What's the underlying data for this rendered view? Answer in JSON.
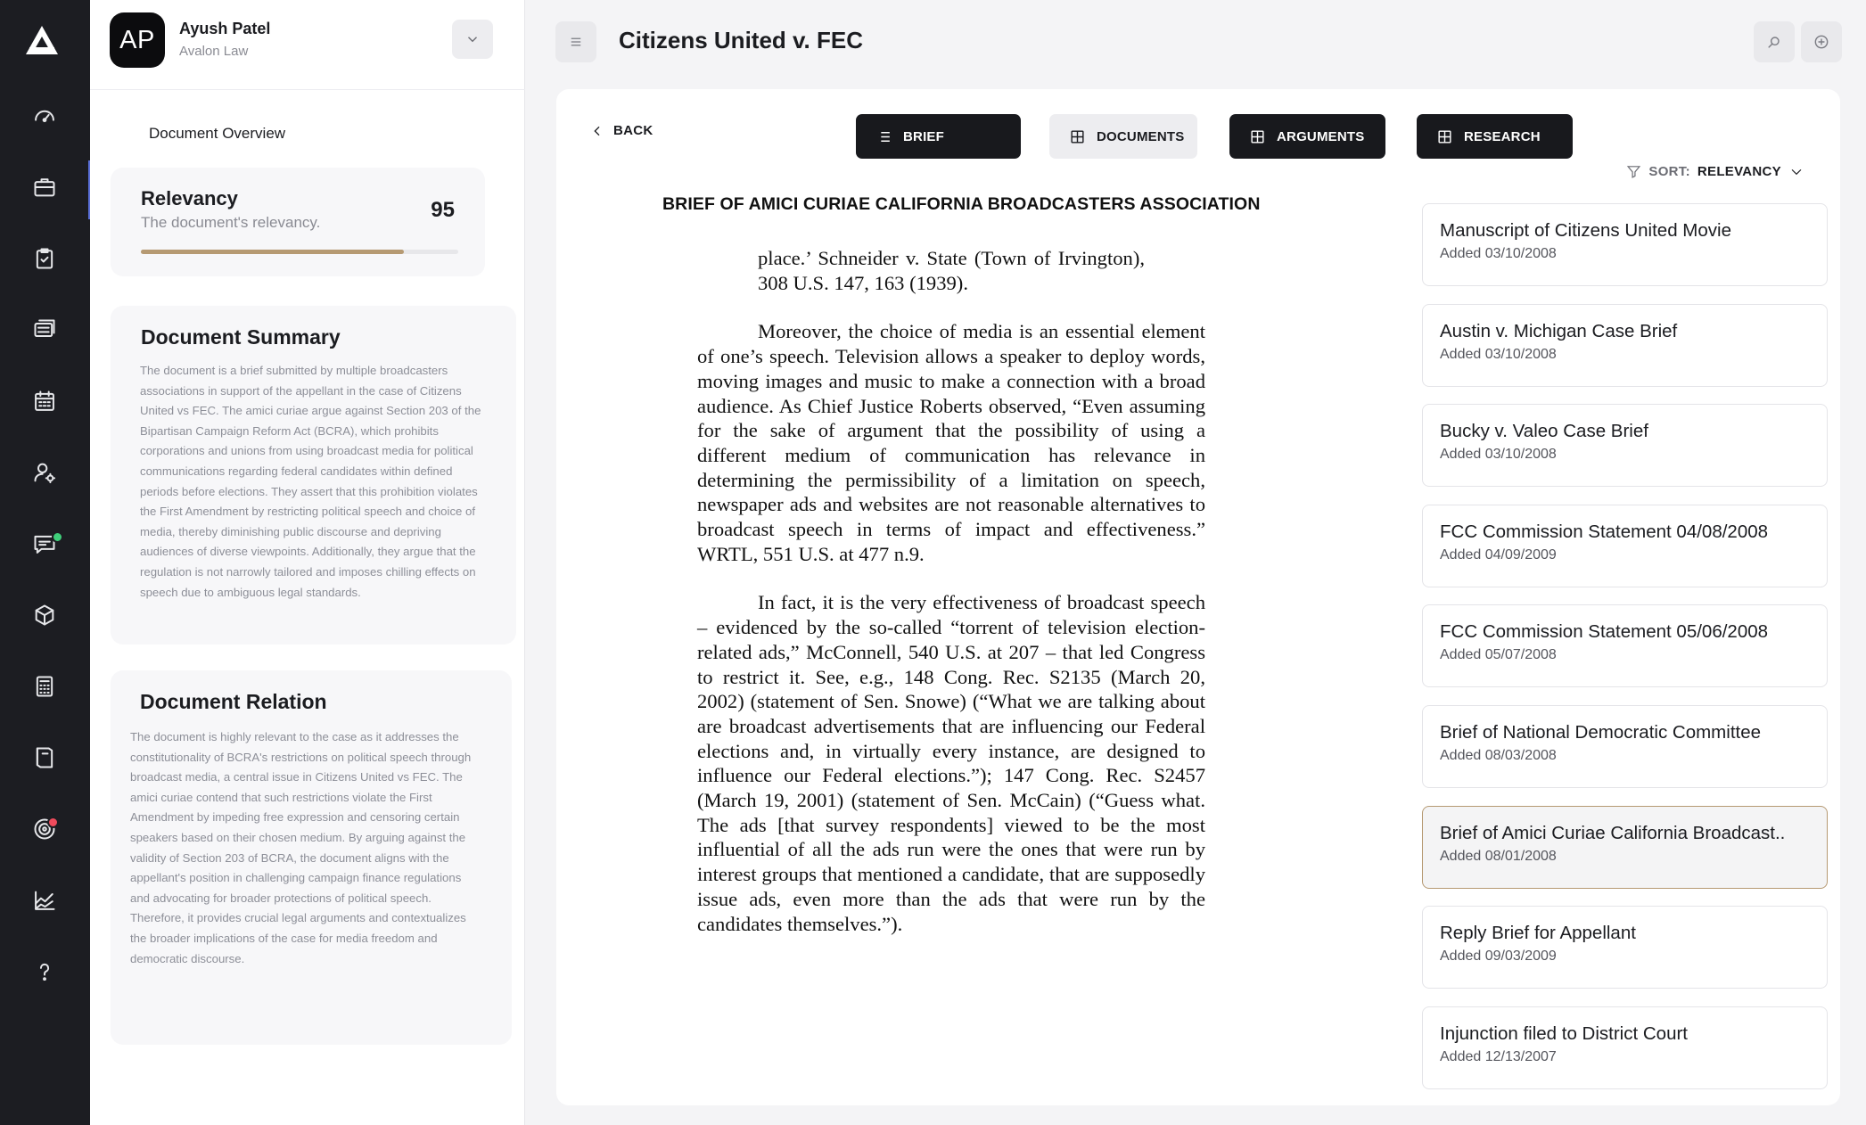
{
  "app": {
    "case_title": "Citizens United v. FEC"
  },
  "rail": {
    "items": [
      {
        "icon": "dashboard-icon"
      },
      {
        "icon": "briefcase-icon",
        "active": true
      },
      {
        "icon": "clipboard-icon"
      },
      {
        "icon": "stack-icon"
      },
      {
        "icon": "calendar-icon"
      },
      {
        "icon": "user-settings-icon"
      },
      {
        "icon": "chat-icon",
        "badge_color": "#3fcf7a"
      },
      {
        "icon": "box-icon"
      },
      {
        "icon": "calculator-icon"
      },
      {
        "icon": "book-icon"
      },
      {
        "icon": "target-icon",
        "badge_color": "#ef4b5c"
      },
      {
        "icon": "chart-icon"
      },
      {
        "icon": "help-icon"
      }
    ]
  },
  "user": {
    "initials": "AP",
    "name": "Ayush Patel",
    "org": "Avalon Law"
  },
  "overview": {
    "title": "Document Overview",
    "relevancy": {
      "title": "Relevancy",
      "subtitle": "The document's relevancy.",
      "value": "95",
      "fraction": 0.83
    },
    "summary": {
      "title": "Document Summary",
      "text": "The document is a brief submitted by multiple broadcasters associations in support of the appellant in the case of Citizens United vs FEC. The amici curiae argue against Section 203 of the Bipartisan Campaign Reform Act (BCRA), which prohibits corporations and unions from using broadcast media for political communications regarding federal candidates within defined periods before elections. They assert that this prohibition violates the First Amendment by restricting political speech and choice of media, thereby diminishing public discourse and depriving audiences of diverse viewpoints. Additionally, they argue that the regulation is not narrowly tailored and imposes chilling effects on speech due to ambiguous legal standards."
    },
    "relation": {
      "title": "Document Relation",
      "text": "The document is highly relevant to the case as it addresses the constitutionality of BCRA's restrictions on political speech through broadcast media, a central issue in Citizens United vs FEC. The amici curiae contend that such restrictions violate the First Amendment by impeding free expression and censoring certain speakers based on their chosen medium. By arguing against the validity of Section 203 of BCRA, the document aligns with the appellant's position in challenging campaign finance regulations and advocating for broader protections of political speech. Therefore, it provides crucial legal arguments and contextualizes the broader implications of the case for media freedom and democratic discourse."
    }
  },
  "nav": {
    "back": "BACK",
    "tabs": [
      {
        "label": "BRIEF",
        "icon": "list-icon",
        "style": "dark"
      },
      {
        "label": "DOCUMENTS",
        "icon": "grid-icon",
        "style": "light"
      },
      {
        "label": "ARGUMENTS",
        "icon": "grid-icon",
        "style": "dark"
      },
      {
        "label": "RESEARCH",
        "icon": "grid-icon",
        "style": "dark"
      }
    ]
  },
  "document": {
    "heading": "BRIEF OF AMICI CURIAE CALIFORNIA BROADCASTERS ASSOCIATION",
    "quote_line": "place.’ Schneider v. State (Town of Irvington), 308 U.S. 147, 163 (1939).",
    "paragraph_1": "Moreover, the choice of media is an essential element of one’s speech. Television allows a speaker to deploy words, moving images and music to make a connection with a broad audience. As Chief Justice Roberts observed, “Even assuming for the sake of argument that the possibility of using a different medium of communication has relevance in determining the permissibility of a limitation on speech, newspaper ads and websites are not reasonable alternatives to broadcast speech in terms of impact and effectiveness.” WRTL, 551 U.S. at 477 n.9.",
    "paragraph_2": "In fact, it is the very effectiveness of broadcast speech – evidenced by the so-called “torrent of television election-related ads,” McConnell, 540 U.S. at 207 – that led Congress to restrict it. See, e.g., 148 Cong. Rec. S2135 (March 20, 2002) (statement of Sen. Snowe) (“What we are talking about are broadcast advertisements that are influencing our Federal elections and, in virtually every instance, are designed to influence our Federal elections.”); 147 Cong. Rec. S2457 (March 19, 2001) (statement of Sen. McCain) (“Guess what. The ads [that survey respondents] viewed to be the most influential of all the ads run were the ones that were run by interest groups that mentioned a candidate, that are supposedly issue ads, even more than the ads that were run by the candidates themselves.”)."
  },
  "sort": {
    "label": "SORT:",
    "value": "RELEVANCY"
  },
  "documents": [
    {
      "title": "Manuscript of Citizens United Movie",
      "added": "Added 03/10/2008"
    },
    {
      "title": "Austin v. Michigan Case Brief",
      "added": "Added 03/10/2008"
    },
    {
      "title": "Bucky v. Valeo Case Brief",
      "added": "Added 03/10/2008"
    },
    {
      "title": "FCC Commission Statement 04/08/2008",
      "added": "Added 04/09/2009"
    },
    {
      "title": "FCC Commission Statement 05/06/2008",
      "added": "Added 05/07/2008"
    },
    {
      "title": "Brief of National Democratic Committee",
      "added": "Added 08/03/2008"
    },
    {
      "title": "Brief of Amici Curiae California Broadcast..",
      "added": "Added 08/01/2008",
      "selected": true
    },
    {
      "title": "Reply Brief for Appellant",
      "added": "Added 09/03/2009"
    },
    {
      "title": "Injunction filed to District Court",
      "added": "Added 12/13/2007"
    }
  ],
  "colors": {
    "accent": "#b69a73",
    "rail_bg": "#1c1d22",
    "tab_dark": "#18191d"
  }
}
